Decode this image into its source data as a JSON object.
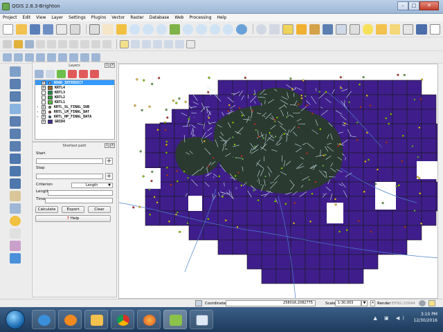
{
  "window": {
    "title": "QGIS 2.8.3-Brighton",
    "controls": [
      "–",
      "□",
      "✕"
    ]
  },
  "menu": [
    "Project",
    "Edit",
    "View",
    "Layer",
    "Settings",
    "Plugins",
    "Vector",
    "Raster",
    "Database",
    "Web",
    "Processing",
    "Help"
  ],
  "layers_panel": {
    "title": "Layers",
    "layers": [
      {
        "name": "ROAD_INTERSECT",
        "checked": true,
        "selected": true,
        "type": "point",
        "color": "#3399ff"
      },
      {
        "name": "KRTL4",
        "checked": true,
        "type": "poly",
        "color": "#8a6d2b"
      },
      {
        "name": "KRTL3",
        "checked": false,
        "type": "poly",
        "color": "#1f8f4a"
      },
      {
        "name": "KRTL2",
        "checked": false,
        "type": "poly",
        "color": "#2e9c3a"
      },
      {
        "name": "KRTL1",
        "checked": false,
        "type": "poly",
        "color": "#5bbf3a"
      },
      {
        "name": "KRTL_SL_FINAL_SUB",
        "checked": true,
        "type": "point",
        "color": "#6aa84f"
      },
      {
        "name": "KRTL_LM_FINAL_DAT",
        "checked": true,
        "type": "point",
        "color": "#c0392b"
      },
      {
        "name": "KRTL_HP_FINAL_DATA",
        "checked": true,
        "type": "point",
        "color": "#1f6fb5"
      },
      {
        "name": "GRID4",
        "checked": true,
        "type": "poly",
        "color": "#3f2a8c"
      }
    ]
  },
  "shortest_path": {
    "title": "Shortest path",
    "start_label": "Start",
    "start_value": "",
    "stop_label": "Stop",
    "stop_value": "",
    "criterion_label": "Criterion",
    "criterion_value": "Length",
    "length_label": "Length",
    "length_value": "",
    "time_label": "Time",
    "time_value": "",
    "calculate": "Calculate",
    "export": "Export",
    "clear": "Clear",
    "help": "Help"
  },
  "status": {
    "coordinate_label": "Coordinate:",
    "coordinate_value": "258016,2082775",
    "scale_label": "Scale",
    "scale_value": "1:30,003",
    "render_label": "Render",
    "crs": "EPSG:32644"
  },
  "taskbar": {
    "time": "3:10 PM",
    "date": "12/30/2016"
  },
  "colors": {
    "grid_fill": "#3f1e8c",
    "grid_stroke": "#1a1a1a",
    "road": "#cfe8ee",
    "urban": "#2a3a30",
    "water_line": "#4a7fd0"
  }
}
